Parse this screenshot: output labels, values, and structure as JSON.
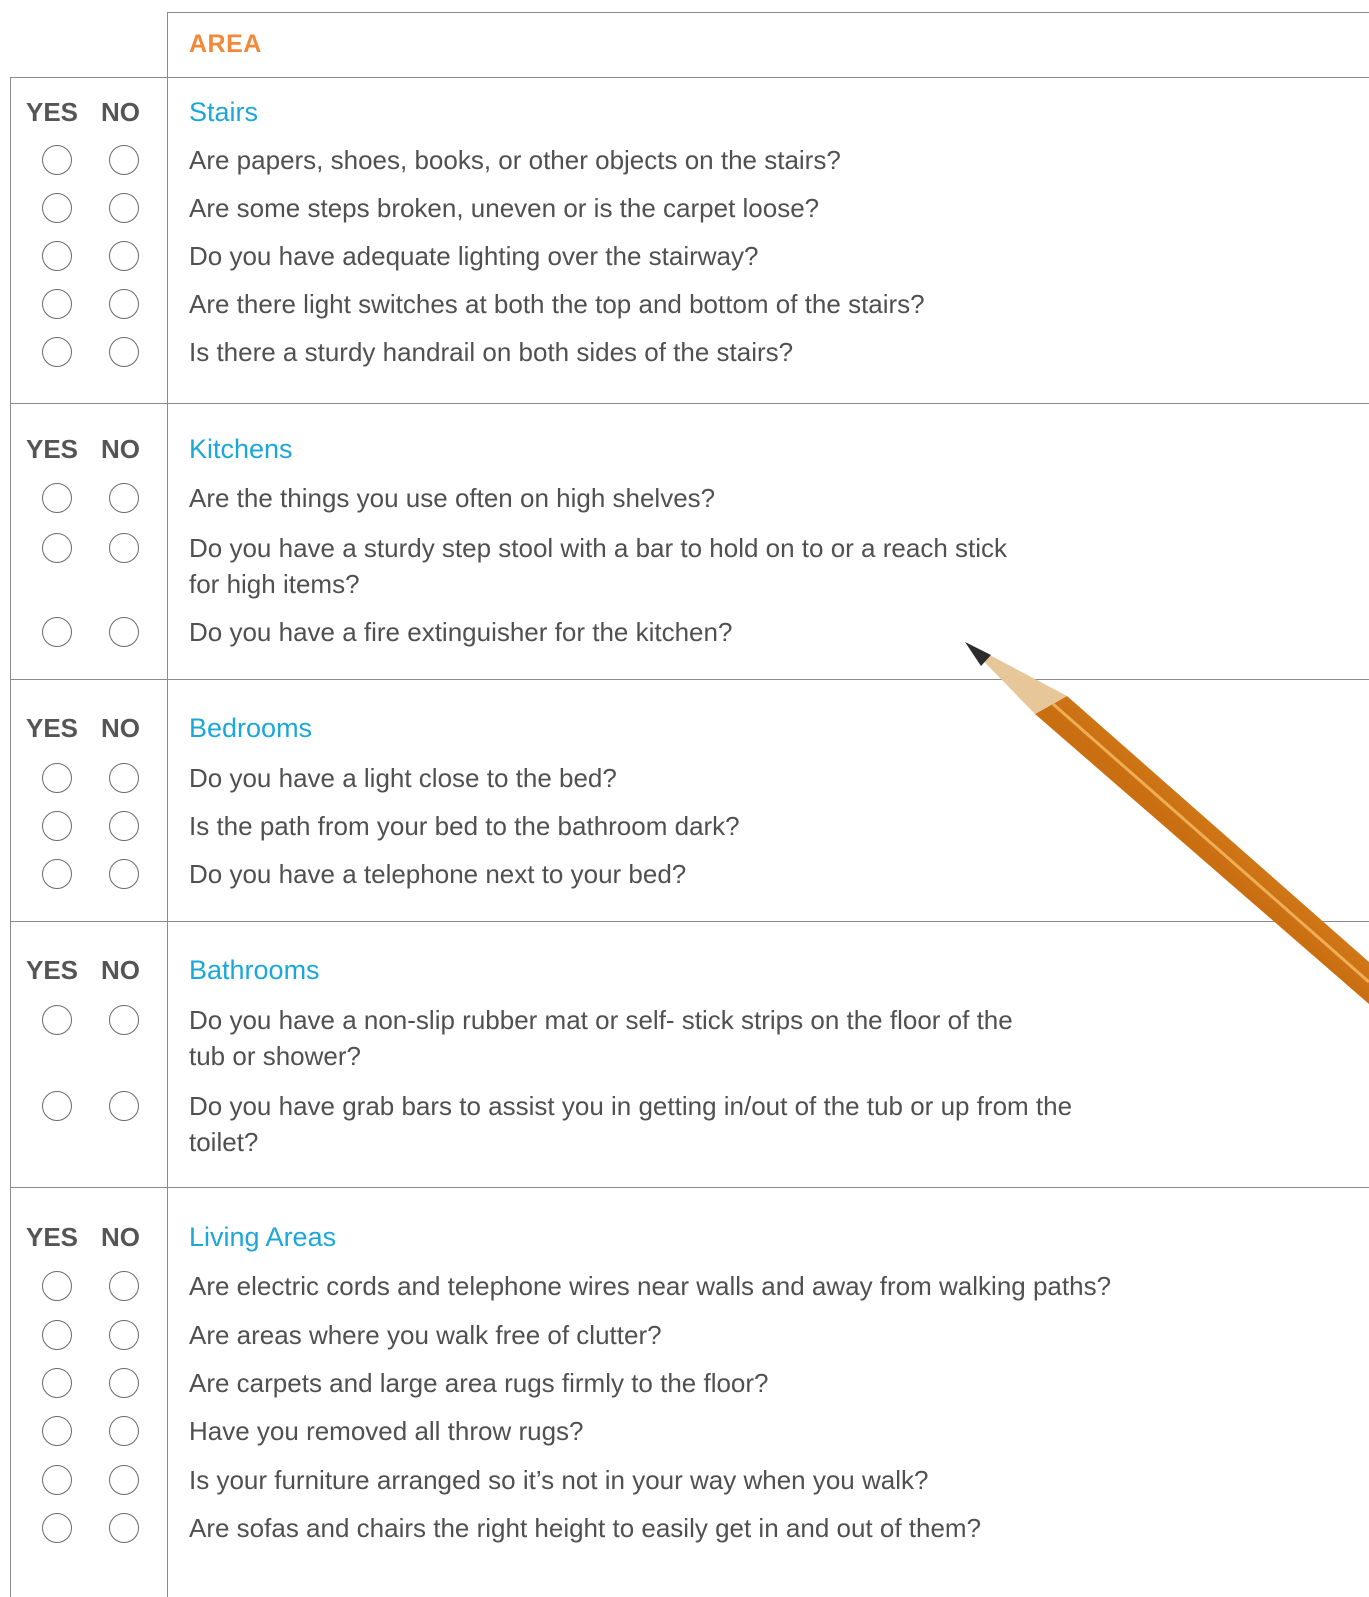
{
  "header": {
    "area_label": "AREA"
  },
  "colors": {
    "area_label": "#F08A3A",
    "section_title": "#1BA7D9"
  },
  "columns": {
    "yes": "YES",
    "no": "NO"
  },
  "sections": [
    {
      "title": "Stairs",
      "questions": [
        {
          "text": "Are papers, shoes, books, or other objects on the stairs?"
        },
        {
          "text": "Are some steps broken, uneven or is the carpet loose?"
        },
        {
          "text": "Do you have adequate lighting over the stairway?"
        },
        {
          "text": "Are there light switches at both the top and bottom of the stairs?"
        },
        {
          "text": "Is there a sturdy handrail on both sides of the stairs?"
        }
      ]
    },
    {
      "title": "Kitchens",
      "questions": [
        {
          "text": "Are the things you use often on high shelves?"
        },
        {
          "text": "Do you have a sturdy step stool with a bar to hold on to or a reach stick",
          "text2": "for high items?"
        },
        {
          "text": "Do you have a fire extinguisher for the kitchen?"
        }
      ]
    },
    {
      "title": "Bedrooms",
      "questions": [
        {
          "text": "Do you have a light close to the bed?"
        },
        {
          "text": "Is the path from your bed to the bathroom dark?"
        },
        {
          "text": "Do you have a telephone next to your bed?"
        }
      ]
    },
    {
      "title": "Bathrooms",
      "questions": [
        {
          "text": "Do you have a non-slip rubber mat or self- stick strips on the floor of the",
          "text2": "tub or shower?"
        },
        {
          "text": "Do you have grab bars to assist you in getting in/out of the tub or up from the",
          "text2": "toilet?"
        }
      ]
    },
    {
      "title": "Living Areas",
      "questions": [
        {
          "text": "Are electric cords and telephone wires near walls and away from walking paths?"
        },
        {
          "text": "Are areas where you walk free of clutter?"
        },
        {
          "text": "Are carpets and large area rugs firmly to the floor?"
        },
        {
          "text": "Have you removed all throw rugs?"
        },
        {
          "text": "Is your furniture arranged so it’s not in your way when you walk?"
        },
        {
          "text": "Are sofas and chairs the right height to easily get in and out of them?"
        }
      ]
    }
  ]
}
